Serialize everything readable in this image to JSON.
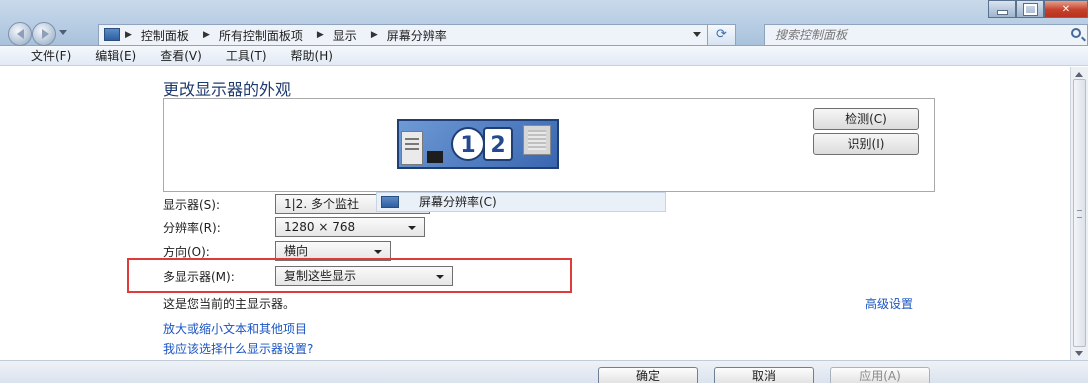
{
  "address_bar": {
    "breadcrumbs": [
      "控制面板",
      "所有控制面板项",
      "显示",
      "屏幕分辨率"
    ],
    "search_placeholder": "搜索控制面板"
  },
  "menu": [
    "文件(F)",
    "编辑(E)",
    "查看(V)",
    "工具(T)",
    "帮助(H)"
  ],
  "page": {
    "title": "更改显示器的外观",
    "monitor_numbers": [
      "1",
      "2"
    ],
    "detect_button": "检测(C)",
    "identify_button": "识别(I)",
    "fields": {
      "display_label": "显示器(S):",
      "display_value": "1|2. 多个监社",
      "resolution_label": "分辨率(R):",
      "resolution_value": "1280 × 768",
      "orientation_label": "方向(O):",
      "orientation_value": "横向",
      "multi_label": "多显示器(M):",
      "multi_value": "复制这些显示"
    },
    "tooltip": "屏幕分辨率(C)",
    "status": "这是您当前的主显示器。",
    "advanced_link": "高级设置",
    "links": [
      "放大或缩小文本和其他项目",
      "我应该选择什么显示器设置?"
    ]
  },
  "footer": {
    "ok": "确定",
    "cancel": "取消",
    "apply": "应用(A)"
  },
  "colors": {
    "highlight": "#e03b3b",
    "link": "#1a55c2",
    "title": "#1e3a6e"
  },
  "icons": [
    "back-arrow-icon",
    "forward-arrow-icon",
    "control-panel-icon",
    "refresh-icon",
    "search-icon",
    "minimize-icon",
    "maximize-icon",
    "close-icon"
  ]
}
